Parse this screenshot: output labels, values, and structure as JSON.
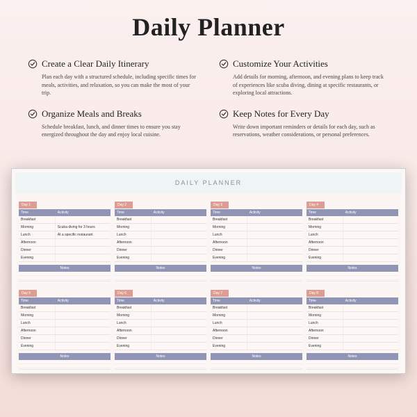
{
  "title": "Daily Planner",
  "features": [
    {
      "title": "Create a Clear Daily Itinerary",
      "desc": "Plan each day with a structured schedule, including specific times for meals, activities, and relaxation, so you can make the most of your trip."
    },
    {
      "title": "Customize Your Activities",
      "desc": "Add details for morning, afternoon, and evening plans to keep track of experiences like scuba diving, dining at specific restaurants, or exploring local attractions."
    },
    {
      "title": "Organize Meals and Breaks",
      "desc": "Schedule breakfast, lunch, and dinner times to ensure you stay energized throughout the day and enjoy local cuisine."
    },
    {
      "title": "Keep Notes for Every Day",
      "desc": "Write down important reminders or details for each day, such as reservations, weather considerations, or personal preferences."
    }
  ],
  "planner": {
    "title": "DAILY PLANNER",
    "time_col": "Time",
    "activity_col": "Activity",
    "notes_label": "Notes",
    "slots": [
      "Breakfast",
      "Morning",
      "Lunch",
      "Afternoon",
      "Dinner",
      "Evening"
    ],
    "days": [
      {
        "label": "Day 1",
        "activities": {
          "Morning": "Scuba diving for 3 hours",
          "Lunch": "At a specific restaurant"
        }
      },
      {
        "label": "Day 2",
        "activities": {}
      },
      {
        "label": "Day 3",
        "activities": {}
      },
      {
        "label": "Day 4",
        "activities": {}
      },
      {
        "label": "Day 5",
        "activities": {}
      },
      {
        "label": "Day 6",
        "activities": {}
      },
      {
        "label": "Day 7",
        "activities": {}
      },
      {
        "label": "Day 8",
        "activities": {}
      }
    ]
  }
}
